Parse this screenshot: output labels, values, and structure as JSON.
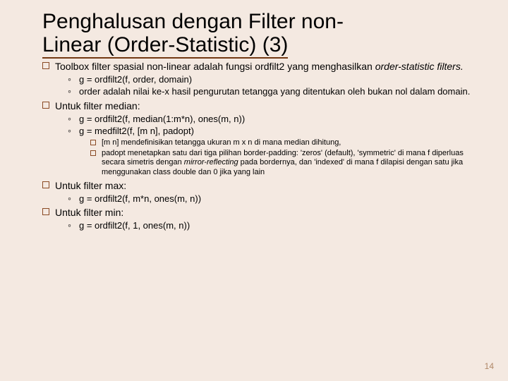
{
  "title_line1": "Penghalusan dengan Filter non-",
  "title_line2": "Linear (Order-Statistic) (3)",
  "b1": {
    "pre": "Toolbox filter spasial non-linear adalah fungsi ordfilt2 yang menghasilkan ",
    "italic": "order-statistic filters.",
    "sub1": "g = ordfilt2(f, order, domain)",
    "sub2": "order adalah nilai ke-x hasil pengurutan tetangga yang ditentukan oleh bukan nol dalam domain."
  },
  "b2": {
    "text": "Untuk filter median:",
    "sub1": "g = ordfilt2(f, median(1:m*n), ones(m, n))",
    "sub2": "g = medfilt2(f, [m n], padopt)",
    "s1": "[m n] mendefinisikan tetangga ukuran m x n di mana median dihitung,",
    "s2": "padopt menetapkan satu dari tiga pilihan border-padding: 'zeros' (default), 'symmetric' di mana f diperluas secara simetris dengan ",
    "s2_italic": "mirror-reflecting",
    "s2_post": " pada bordernya, dan 'indexed' di mana f dilapisi dengan satu jika menggunakan class double dan 0 jika yang lain"
  },
  "b3": {
    "text": "Untuk filter max:",
    "sub1": "g = ordfilt2(f, m*n, ones(m, n))"
  },
  "b4": {
    "text": "Untuk filter min:",
    "sub1": "g = ordfilt2(f, 1, ones(m, n))"
  },
  "page": "14"
}
